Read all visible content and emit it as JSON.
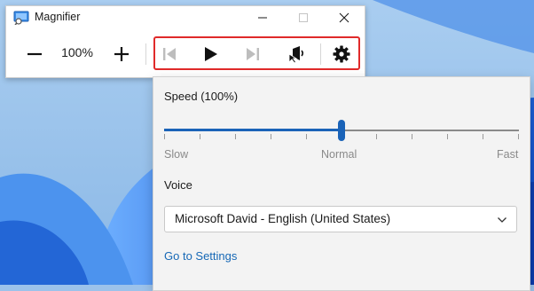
{
  "window": {
    "title": "Magnifier",
    "controls": [
      "minimize-icon",
      "maximize-icon",
      "close-icon"
    ]
  },
  "toolbar": {
    "zoom_out_icon": "minus-icon",
    "zoom_level": "100%",
    "zoom_in_icon": "plus-icon",
    "read_controls": [
      "previous-icon",
      "play-icon",
      "next-icon",
      "speaker-icon"
    ],
    "settings_icon": "gear-icon"
  },
  "flyout": {
    "speed_label": "Speed (100%)",
    "speed_fraction": 0.5,
    "tick_count": 11,
    "slider_labels": {
      "slow": "Slow",
      "normal": "Normal",
      "fast": "Fast"
    },
    "voice_label": "Voice",
    "voice_value": "Microsoft David - English (United States)",
    "settings_link": "Go to Settings"
  },
  "colors": {
    "accent": "#1a63b8",
    "highlight_border": "#e02a2a",
    "link": "#1668b6"
  }
}
